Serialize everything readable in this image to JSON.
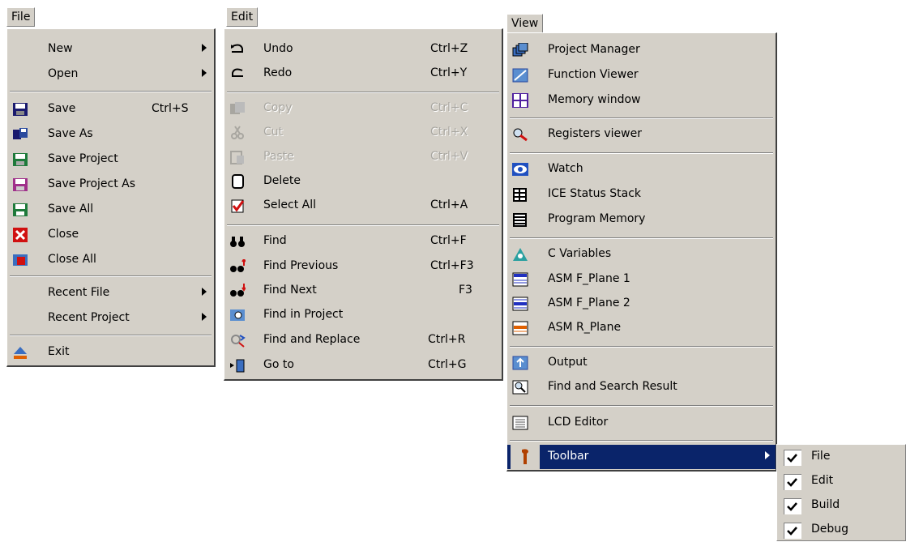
{
  "file_menu": {
    "title": "File",
    "items": [
      {
        "label": "New",
        "submenu": true
      },
      {
        "label": "Open",
        "submenu": true
      },
      {
        "label": "Save",
        "shortcut": "Ctrl+S",
        "icon": "floppy-icon"
      },
      {
        "label": "Save As",
        "icon": "save-as-icon"
      },
      {
        "label": "Save Project",
        "icon": "save-project-icon"
      },
      {
        "label": "Save Project As",
        "icon": "save-project-as-icon"
      },
      {
        "label": "Save All",
        "icon": "save-all-icon"
      },
      {
        "label": "Close",
        "icon": "close-icon"
      },
      {
        "label": "Close All",
        "icon": "close-all-icon"
      },
      {
        "label": "Recent File",
        "submenu": true
      },
      {
        "label": "Recent Project",
        "submenu": true
      },
      {
        "label": "Exit",
        "icon": "eject-icon"
      }
    ]
  },
  "edit_menu": {
    "title": "Edit",
    "items": [
      {
        "label": "Undo",
        "shortcut": "Ctrl+Z",
        "icon": "undo-icon"
      },
      {
        "label": "Redo",
        "shortcut": "Ctrl+Y",
        "icon": "redo-icon"
      },
      {
        "label": "Copy",
        "shortcut": "Ctrl+C",
        "icon": "copy-icon",
        "disabled": true
      },
      {
        "label": "Cut",
        "shortcut": "Ctrl+X",
        "icon": "cut-icon",
        "disabled": true
      },
      {
        "label": "Paste",
        "shortcut": "Ctrl+V",
        "icon": "paste-icon",
        "disabled": true
      },
      {
        "label": "Delete",
        "icon": "delete-icon"
      },
      {
        "label": "Select All",
        "shortcut": "Ctrl+A",
        "icon": "select-all-icon"
      },
      {
        "label": "Find",
        "shortcut": "Ctrl+F",
        "icon": "binoculars-icon"
      },
      {
        "label": "Find Previous",
        "shortcut": "Ctrl+F3",
        "icon": "find-previous-icon"
      },
      {
        "label": "Find Next",
        "shortcut": "F3",
        "icon": "find-next-icon"
      },
      {
        "label": "Find in Project",
        "icon": "find-in-project-icon"
      },
      {
        "label": "Find and Replace",
        "shortcut": "Ctrl+R",
        "icon": "find-replace-icon"
      },
      {
        "label": "Go to",
        "shortcut": "Ctrl+G",
        "icon": "goto-icon"
      }
    ]
  },
  "view_menu": {
    "title": "View",
    "items": [
      {
        "label": "Project Manager",
        "icon": "project-manager-icon"
      },
      {
        "label": "Function Viewer",
        "icon": "function-viewer-icon"
      },
      {
        "label": "Memory window",
        "icon": "memory-window-icon"
      },
      {
        "label": "Registers viewer",
        "icon": "registers-icon"
      },
      {
        "label": "Watch",
        "icon": "eye-icon"
      },
      {
        "label": "ICE Status Stack",
        "icon": "stack-icon"
      },
      {
        "label": "Program Memory",
        "icon": "program-memory-icon"
      },
      {
        "label": "C Variables",
        "icon": "c-variables-icon"
      },
      {
        "label": "ASM F_Plane 1",
        "icon": "plane-blue-icon"
      },
      {
        "label": "ASM F_Plane 2",
        "icon": "plane-blue2-icon"
      },
      {
        "label": "ASM R_Plane",
        "icon": "plane-orange-icon"
      },
      {
        "label": "Output",
        "icon": "output-icon"
      },
      {
        "label": "Find and Search Result",
        "icon": "search-result-icon"
      },
      {
        "label": "LCD Editor",
        "icon": "lcd-icon"
      },
      {
        "label": "Toolbar",
        "icon": "wrench-icon",
        "submenu": true,
        "highlighted": true
      }
    ]
  },
  "toolbar_submenu": {
    "items": [
      {
        "label": "File",
        "checked": true
      },
      {
        "label": "Edit",
        "checked": true
      },
      {
        "label": "Build",
        "checked": true
      },
      {
        "label": "Debug",
        "checked": true
      }
    ]
  },
  "colors": {
    "menu_bg": "#d4d0c8",
    "highlight": "#0a246a"
  }
}
